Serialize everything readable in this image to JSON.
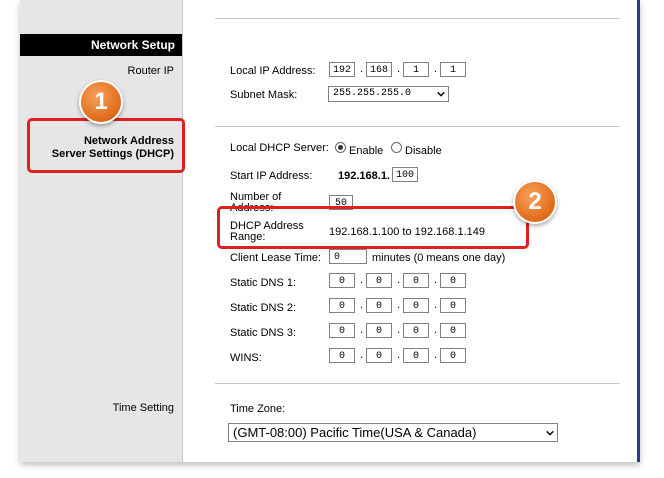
{
  "sidebar": {
    "section_title": "Network Setup",
    "router_ip_label": "Router IP",
    "dhcp_label_line1": "Network Address",
    "dhcp_label_line2": "Server Settings (DHCP)",
    "time_setting_label": "Time Setting"
  },
  "router_ip": {
    "local_ip_label": "Local IP Address:",
    "local_ip": [
      "192",
      "168",
      "1",
      "1"
    ],
    "subnet_label": "Subnet Mask:",
    "subnet_value": "255.255.255.0"
  },
  "dhcp": {
    "server_label": "Local DHCP Server:",
    "enable_label": "Enable",
    "disable_label": "Disable",
    "selected": "Enable",
    "start_ip_label": "Start IP Address:",
    "start_ip_prefix": "192.168.1.",
    "start_ip_last": "100",
    "number_label_line1": "Number  of",
    "number_label_line2": "Address:",
    "number_value": "50",
    "range_label_line1": "DHCP Address",
    "range_label_line2": "Range:",
    "range_value": "192.168.1.100 to 192.168.1.149",
    "lease_label": "Client Lease Time:",
    "lease_value": "0",
    "lease_note": "minutes (0 means one day)",
    "dns1_label": "Static DNS 1:",
    "dns1": [
      "0",
      "0",
      "0",
      "0"
    ],
    "dns2_label": "Static DNS 2:",
    "dns2": [
      "0",
      "0",
      "0",
      "0"
    ],
    "dns3_label": "Static DNS 3:",
    "dns3": [
      "0",
      "0",
      "0",
      "0"
    ],
    "wins_label": "WINS:",
    "wins": [
      "0",
      "0",
      "0",
      "0"
    ]
  },
  "time": {
    "zone_label": "Time Zone:",
    "zone_value": "(GMT-08:00) Pacific Time(USA & Canada)"
  },
  "annotations": {
    "badge1": "1",
    "badge2": "2",
    "highlight_color": "#e0201c",
    "badge_color": "#e8731f"
  },
  "colors": {
    "section_bar": "#000000",
    "left_panel": "#e6e6e6",
    "right_stripe": "#2c3a8c"
  }
}
